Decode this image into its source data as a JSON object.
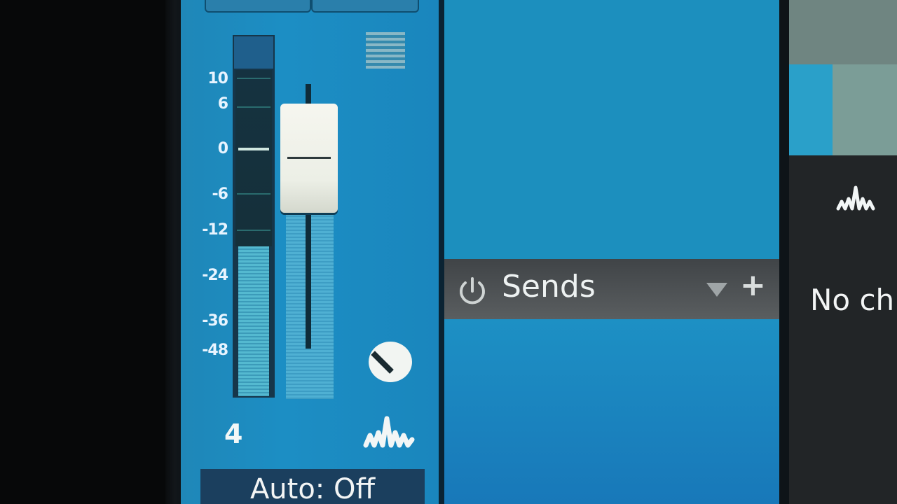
{
  "channel_strip": {
    "meter_scale": [
      "10",
      "6",
      "0",
      "-6",
      "-12",
      "-24",
      "-36",
      "-48"
    ],
    "channel_number": "4",
    "automation_label": "Auto: Off"
  },
  "sends_panel": {
    "label": "Sends",
    "add_label": "+"
  },
  "right_panel": {
    "status_text": "No ch"
  },
  "icons": {
    "grip": "grip-lines-icon",
    "pan_knob": "pan-knob-icon",
    "channel_eq": "eq-wave-icon",
    "sends_power": "power-icon",
    "sends_dropdown": "triangle-down-icon",
    "right_eq": "eq-wave-icon"
  },
  "colors": {
    "channel_blue": "#1c8ec4",
    "panel_blue": "#1c8fbe",
    "sends_bar": "#4a4e51",
    "fader_cap": "#eef0e8"
  }
}
